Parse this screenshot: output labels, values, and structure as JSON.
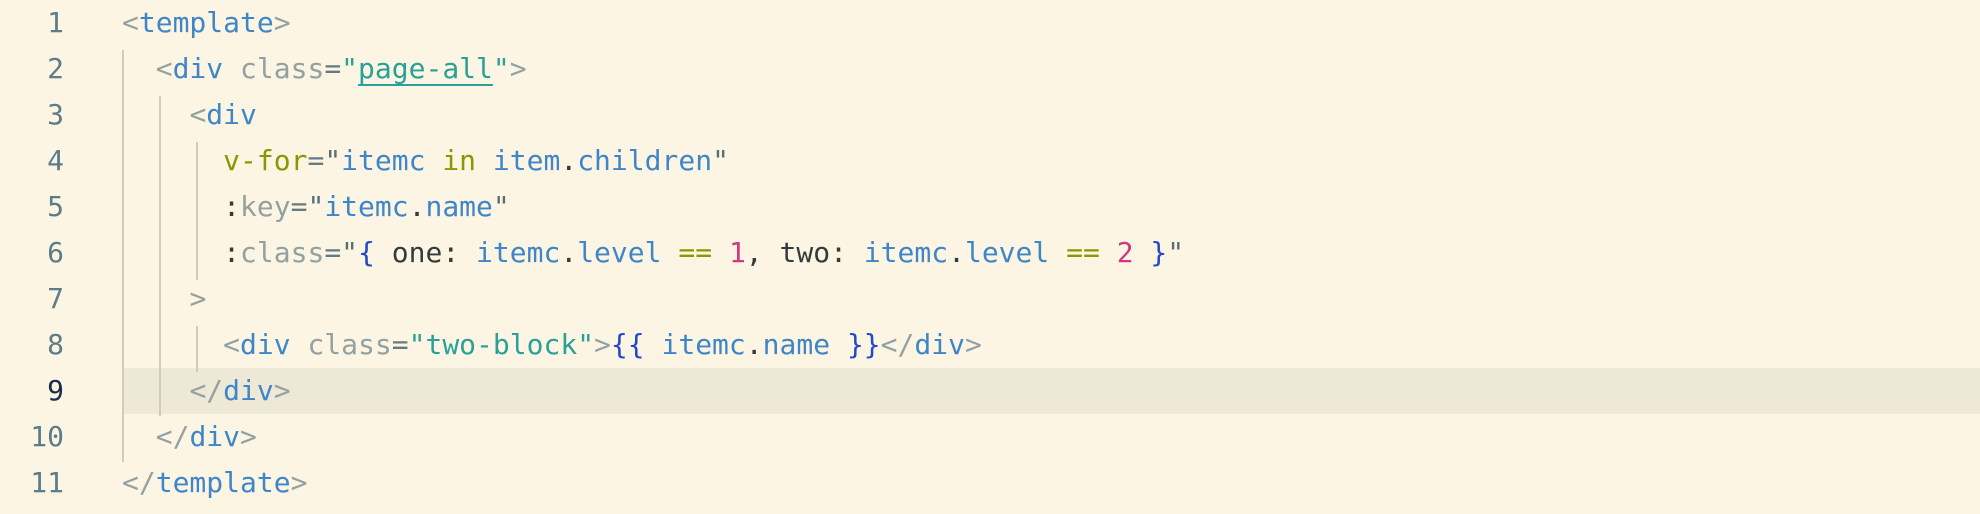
{
  "editor": {
    "active_line": 9,
    "lines": [
      {
        "num": "1",
        "tokens": [
          [
            "punct",
            "<"
          ],
          [
            "tag",
            "template"
          ],
          [
            "punct",
            ">"
          ]
        ]
      },
      {
        "num": "2",
        "tokens": [
          [
            "plain",
            "  "
          ],
          [
            "punct",
            "<"
          ],
          [
            "tag",
            "div"
          ],
          [
            "plain",
            " "
          ],
          [
            "attr",
            "class"
          ],
          [
            "eq",
            "="
          ],
          [
            "strq",
            "\""
          ],
          [
            "str_u",
            "page-all"
          ],
          [
            "strq",
            "\""
          ],
          [
            "punct",
            ">"
          ]
        ]
      },
      {
        "num": "3",
        "tokens": [
          [
            "plain",
            "    "
          ],
          [
            "punct",
            "<"
          ],
          [
            "tag",
            "div"
          ]
        ]
      },
      {
        "num": "4",
        "tokens": [
          [
            "plain",
            "      "
          ],
          [
            "dir",
            "v-for"
          ],
          [
            "eq",
            "="
          ],
          [
            "quote",
            "\""
          ],
          [
            "var",
            "itemc"
          ],
          [
            "plain",
            " "
          ],
          [
            "kw",
            "in"
          ],
          [
            "plain",
            " "
          ],
          [
            "var",
            "item"
          ],
          [
            "plain",
            "."
          ],
          [
            "var",
            "children"
          ],
          [
            "quote",
            "\""
          ]
        ]
      },
      {
        "num": "5",
        "tokens": [
          [
            "plain",
            "      "
          ],
          [
            "plain",
            ":"
          ],
          [
            "attr",
            "key"
          ],
          [
            "eq",
            "="
          ],
          [
            "quote",
            "\""
          ],
          [
            "var",
            "itemc"
          ],
          [
            "plain",
            "."
          ],
          [
            "var",
            "name"
          ],
          [
            "quote",
            "\""
          ]
        ]
      },
      {
        "num": "6",
        "tokens": [
          [
            "plain",
            "      "
          ],
          [
            "plain",
            ":"
          ],
          [
            "attr",
            "class"
          ],
          [
            "eq",
            "="
          ],
          [
            "quote",
            "\""
          ],
          [
            "brace",
            "{"
          ],
          [
            "plain",
            " one: "
          ],
          [
            "var",
            "itemc"
          ],
          [
            "plain",
            "."
          ],
          [
            "var",
            "level"
          ],
          [
            "plain",
            " "
          ],
          [
            "op",
            "=="
          ],
          [
            "plain",
            " "
          ],
          [
            "num",
            "1"
          ],
          [
            "plain",
            ", two: "
          ],
          [
            "var",
            "itemc"
          ],
          [
            "plain",
            "."
          ],
          [
            "var",
            "level"
          ],
          [
            "plain",
            " "
          ],
          [
            "op",
            "=="
          ],
          [
            "plain",
            " "
          ],
          [
            "num",
            "2"
          ],
          [
            "plain",
            " "
          ],
          [
            "brace",
            "}"
          ],
          [
            "quote",
            "\""
          ]
        ]
      },
      {
        "num": "7",
        "tokens": [
          [
            "plain",
            "    "
          ],
          [
            "punct",
            ">"
          ]
        ]
      },
      {
        "num": "8",
        "tokens": [
          [
            "plain",
            "      "
          ],
          [
            "punct",
            "<"
          ],
          [
            "tag",
            "div"
          ],
          [
            "plain",
            " "
          ],
          [
            "attr",
            "class"
          ],
          [
            "eq",
            "="
          ],
          [
            "strq",
            "\""
          ],
          [
            "str",
            "two-block"
          ],
          [
            "strq",
            "\""
          ],
          [
            "punct",
            ">"
          ],
          [
            "brace",
            "{{"
          ],
          [
            "plain",
            " "
          ],
          [
            "var",
            "itemc"
          ],
          [
            "plain",
            "."
          ],
          [
            "var",
            "name"
          ],
          [
            "plain",
            " "
          ],
          [
            "brace",
            "}}"
          ],
          [
            "punct",
            "</"
          ],
          [
            "tag",
            "div"
          ],
          [
            "punct",
            ">"
          ]
        ]
      },
      {
        "num": "9",
        "tokens": [
          [
            "plain",
            "    "
          ],
          [
            "punct",
            "</"
          ],
          [
            "tag",
            "div"
          ],
          [
            "punct",
            ">"
          ]
        ]
      },
      {
        "num": "10",
        "tokens": [
          [
            "plain",
            "  "
          ],
          [
            "punct",
            "</"
          ],
          [
            "tag",
            "div"
          ],
          [
            "punct",
            ">"
          ]
        ]
      },
      {
        "num": "11",
        "tokens": [
          [
            "punct",
            "</"
          ],
          [
            "tag",
            "template"
          ],
          [
            "punct",
            ">"
          ]
        ]
      }
    ]
  }
}
